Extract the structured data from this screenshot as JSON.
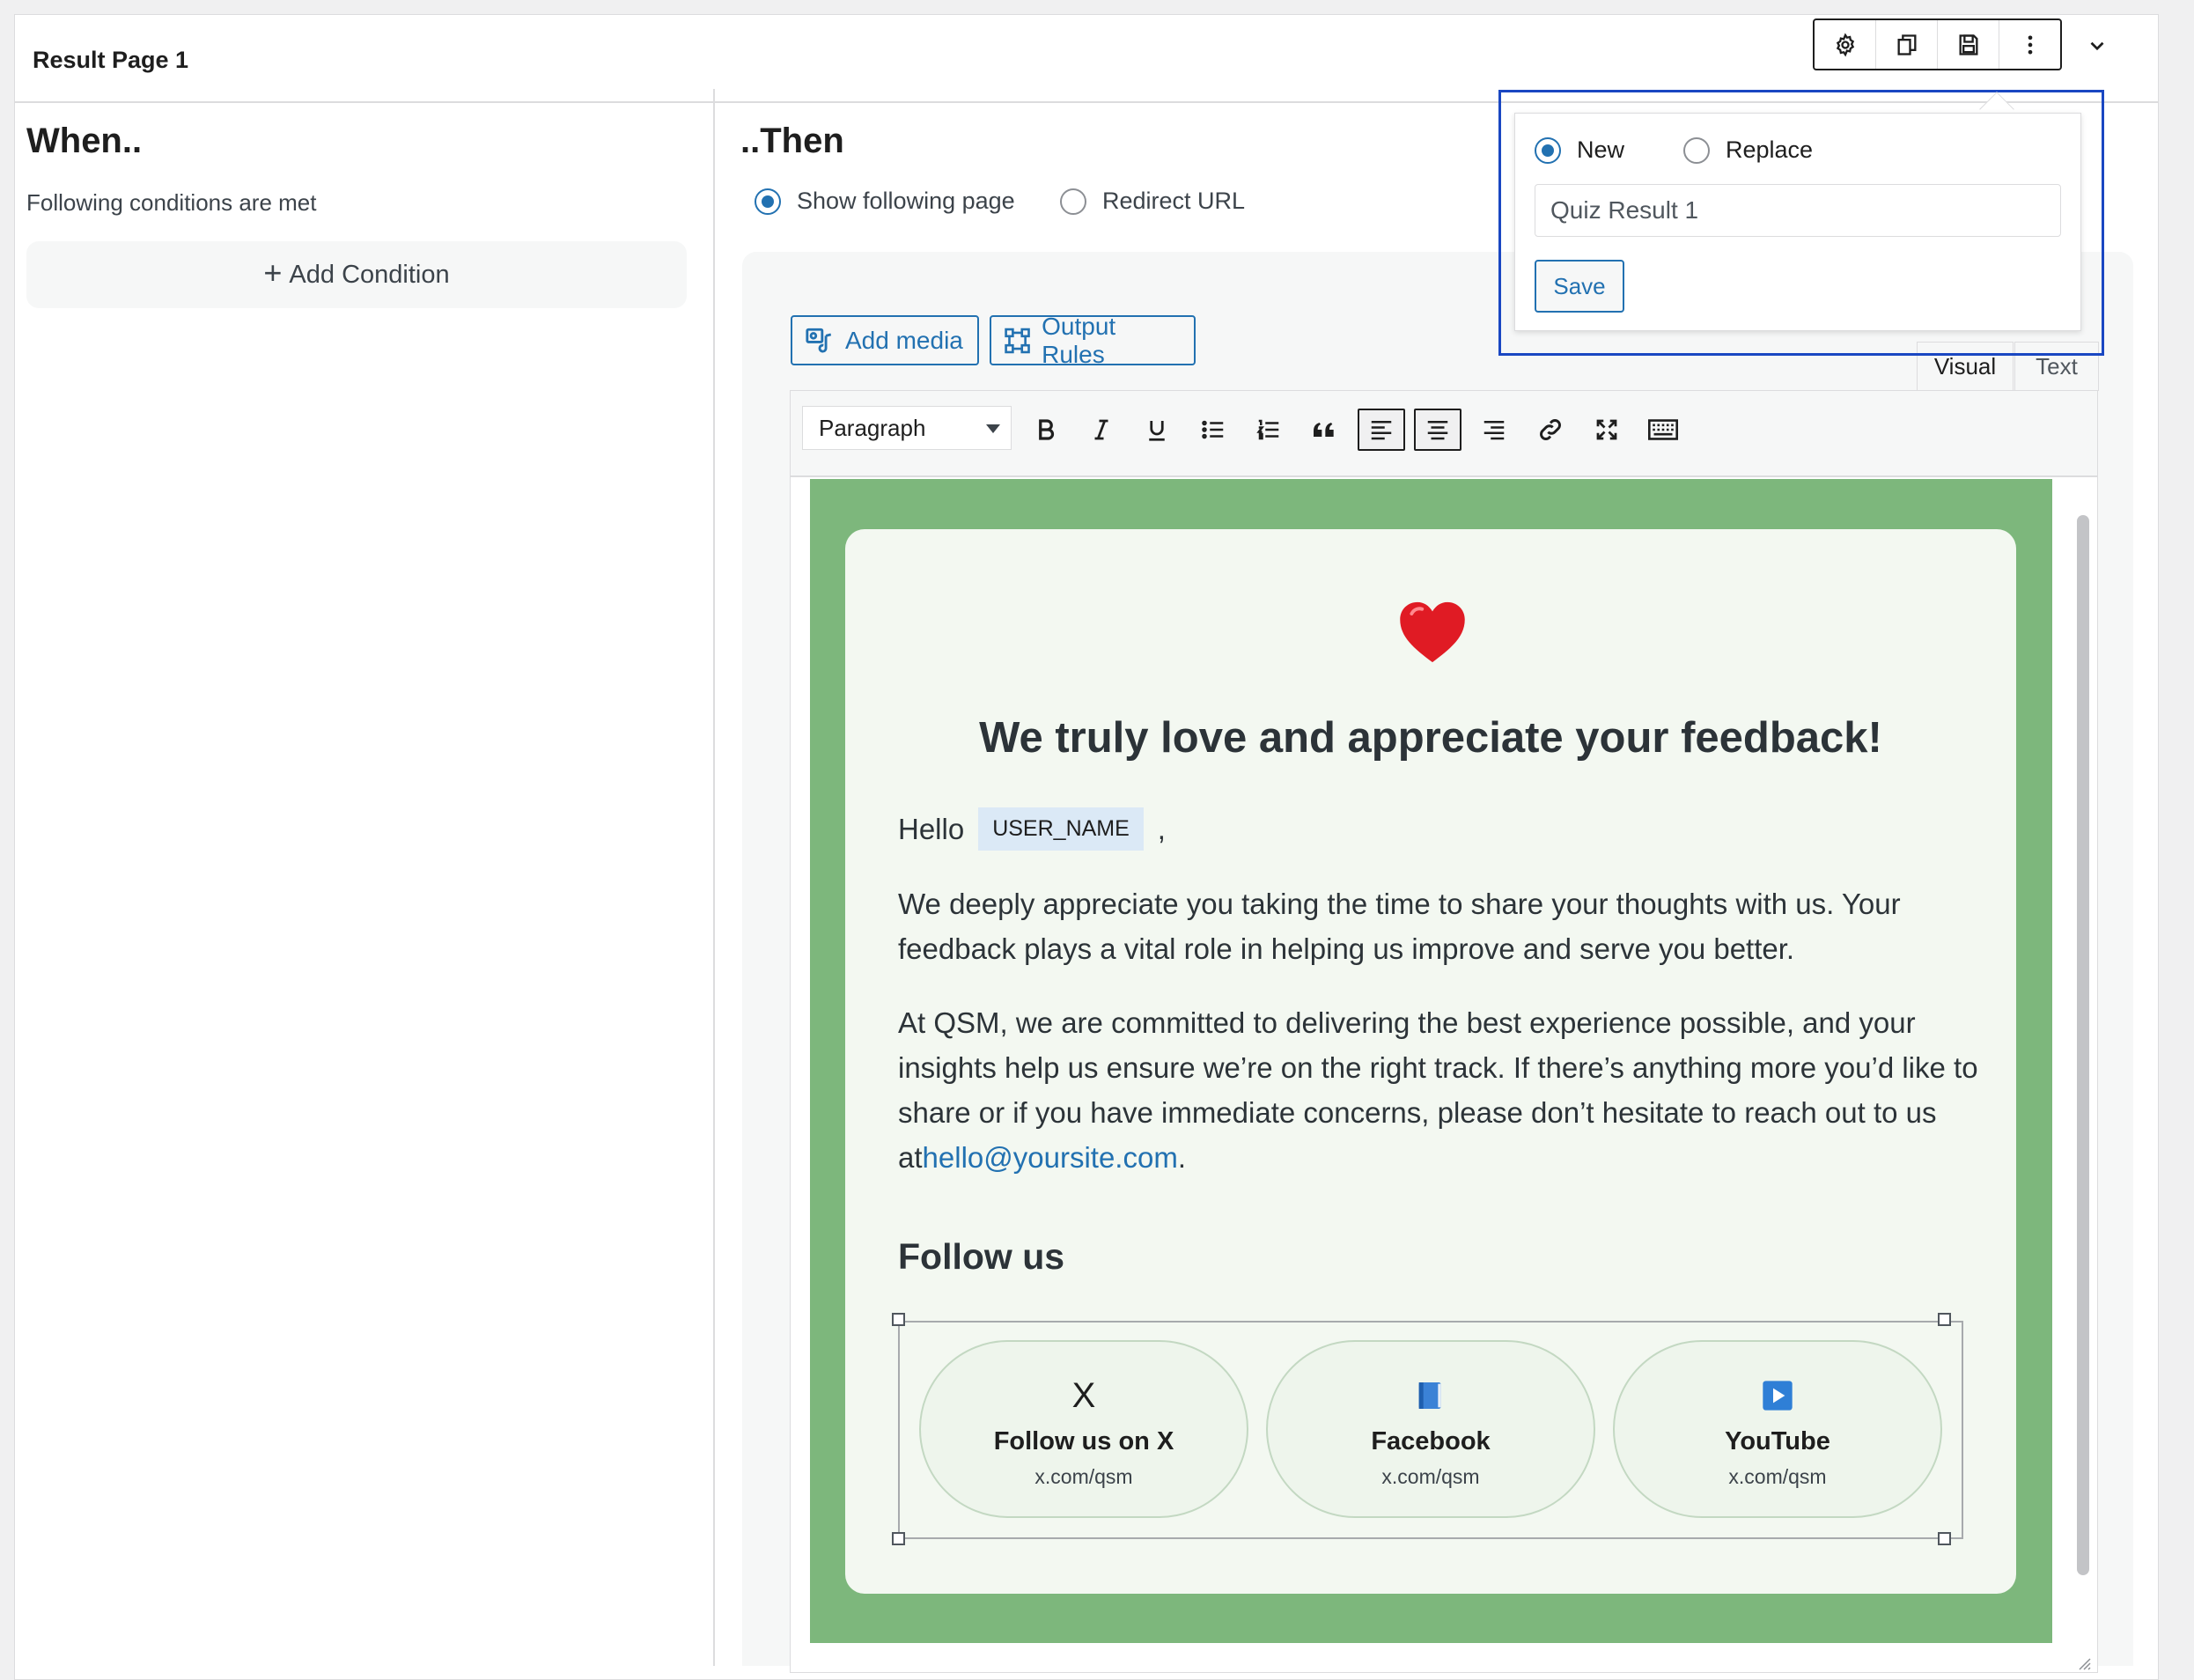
{
  "header": {
    "title": "Result Page 1",
    "toolbar": {
      "icons": [
        "gear-icon",
        "duplicate-icon",
        "save-icon",
        "more-vertical-icon"
      ]
    },
    "collapse_icon": "chevron-down-icon"
  },
  "when": {
    "title": "When..",
    "subtitle": "Following conditions are met",
    "add_condition": {
      "plus": "+",
      "label": "Add Condition"
    }
  },
  "then": {
    "title": "..Then",
    "options": [
      {
        "label": "Show following page",
        "checked": true
      },
      {
        "label": "Redirect URL",
        "checked": false
      }
    ]
  },
  "editor": {
    "buttons": {
      "add_media": "Add media",
      "output_rules": "Output Rules"
    },
    "tabs": {
      "visual": "Visual",
      "text": "Text"
    },
    "format_select": "Paragraph",
    "content": {
      "heading": "We truly love and appreciate your feedback!",
      "hello": "Hello",
      "variable": "USER_NAME",
      "comma": ",",
      "para1": "We deeply appreciate you taking the time to share your thoughts with us. Your feedback plays a vital role in helping us improve and serve you better.",
      "para2": "At QSM, we are committed to delivering the best experience possible, and your insights help us ensure we’re on the right track. If there’s anything more you’d like to share or if you have immediate concerns, please don’t hesitate to reach out to us at",
      "email": "hello@yoursite.com",
      "period": ".",
      "follow_title": "Follow us",
      "socials": [
        {
          "icon": "X",
          "name": "Follow us on X",
          "url": "x.com/qsm"
        },
        {
          "icon": "book-icon",
          "name": "Facebook",
          "url": "x.com/qsm"
        },
        {
          "icon": "play-icon",
          "name": "YouTube",
          "url": "x.com/qsm"
        }
      ]
    },
    "colors": {
      "background_green": "#7db77c",
      "card_bg": "#f3f8f1",
      "accent": "#2271b1"
    }
  },
  "popover": {
    "options": [
      {
        "label": "New",
        "checked": true
      },
      {
        "label": "Replace",
        "checked": false
      }
    ],
    "input_value": "Quiz Result 1",
    "save_label": "Save"
  }
}
